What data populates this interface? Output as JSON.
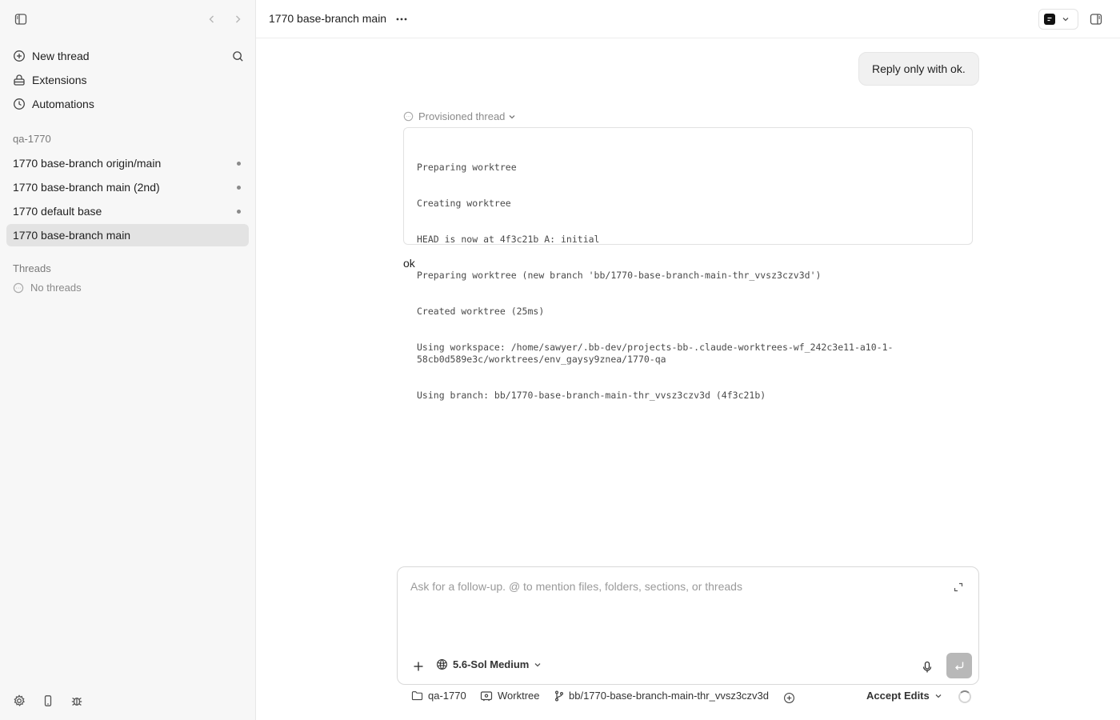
{
  "sidebar": {
    "nav": [
      {
        "label": "New thread",
        "icon": "plus-circle-icon"
      },
      {
        "label": "Extensions",
        "icon": "extensions-icon"
      },
      {
        "label": "Automations",
        "icon": "clock-icon"
      }
    ],
    "project_label": "qa-1770",
    "projects": [
      {
        "label": "1770 base-branch origin/main",
        "active": false,
        "dot": true
      },
      {
        "label": "1770 base-branch main (2nd)",
        "active": false,
        "dot": true
      },
      {
        "label": "1770 default base",
        "active": false,
        "dot": true
      },
      {
        "label": "1770 base-branch main",
        "active": true,
        "dot": false
      }
    ],
    "threads_label": "Threads",
    "no_threads": "No threads"
  },
  "header": {
    "title": "1770 base-branch main"
  },
  "conversation": {
    "user_message": "Reply only with ok.",
    "provisioned_label": "Provisioned thread",
    "log_lines": [
      "Preparing worktree",
      "Creating worktree",
      "HEAD is now at 4f3c21b A: initial",
      "Preparing worktree (new branch 'bb/1770-base-branch-main-thr_vvsz3czv3d')",
      "Created worktree (25ms)",
      "Using workspace: /home/sawyer/.bb-dev/projects-bb-.claude-worktrees-wf_242c3e11-a10-1-58cb0d589e3c/worktrees/env_gaysy9znea/1770-qa",
      "Using branch: bb/1770-base-branch-main-thr_vvsz3czv3d (4f3c21b)"
    ],
    "assistant_reply": "ok"
  },
  "composer": {
    "placeholder": "Ask for a follow-up. @ to mention files, folders, sections, or threads",
    "value": "",
    "model": "5.6-Sol Medium"
  },
  "status": {
    "folder": "qa-1770",
    "mode": "Worktree",
    "branch": "bb/1770-base-branch-main-thr_vvsz3czv3d",
    "accept": "Accept Edits"
  }
}
